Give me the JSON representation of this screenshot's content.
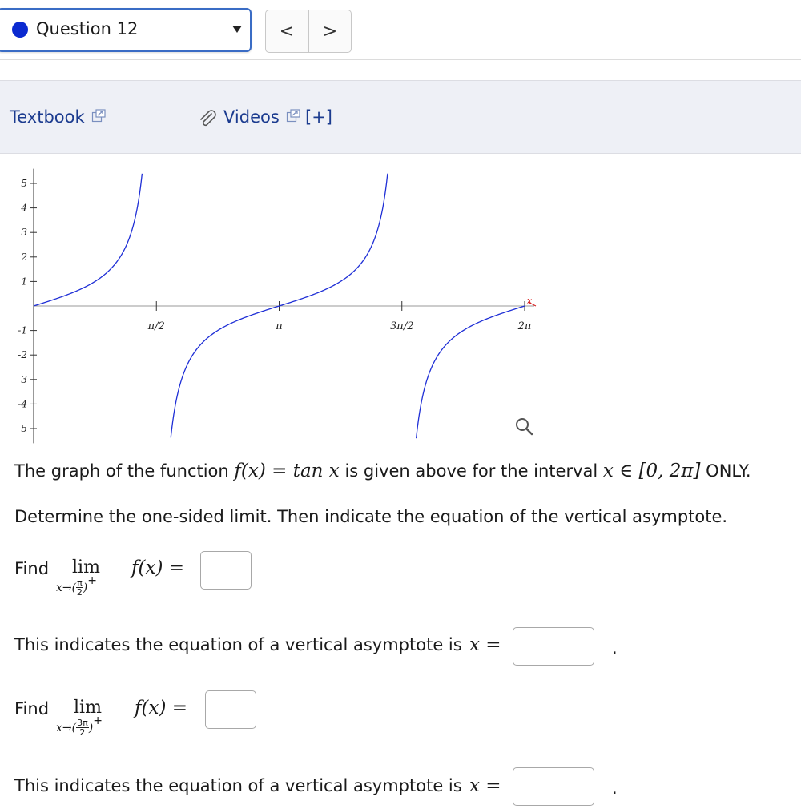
{
  "nav": {
    "question_label": "Question 12",
    "prev_label": "<",
    "next_label": ">"
  },
  "resources": {
    "textbook_label": "Textbook",
    "videos_label": "Videos",
    "expand_label": "[+]"
  },
  "colors": {
    "curve": "#1f2fd6",
    "axis_marker": "#d61a1a",
    "link": "#1b3b8f"
  },
  "chart_data": {
    "type": "line",
    "function": "tan x",
    "xlim": [
      0,
      6.2832
    ],
    "ylim": [
      -5,
      5
    ],
    "x_tick_labels": [
      "π/2",
      "π",
      "3π/2",
      "2π"
    ],
    "x_ticks": [
      1.5708,
      3.1416,
      4.7124,
      6.2832
    ],
    "y_tick_labels": [
      "5",
      "4",
      "3",
      "2",
      "1",
      "-1",
      "-2",
      "-3",
      "-4",
      "-5"
    ],
    "y_ticks": [
      5,
      4,
      3,
      2,
      1,
      -1,
      -2,
      -3,
      -4,
      -5
    ],
    "x_axis_marker": "x",
    "zoom_icon": "magnifier-icon"
  },
  "problem": {
    "intro_1": "The graph of the function ",
    "intro_func": "f(x) = tan x",
    "intro_2": " is given above for the interval ",
    "intro_interval": "x ∈ [0, 2π]",
    "intro_3": " ONLY.",
    "instruction": "Determine the one-sided limit. Then indicate the equation of the vertical asymptote.",
    "find_label": "Find",
    "lim": "lim",
    "limit1_point_num": "π",
    "limit1_point_den": "2",
    "limit2_point_num": "3π",
    "limit2_point_den": "2",
    "fx_equals": "f(x) =",
    "asymptote_text": "This indicates the equation of a vertical asymptote is",
    "asymptote_var": "x =",
    "period": "."
  }
}
